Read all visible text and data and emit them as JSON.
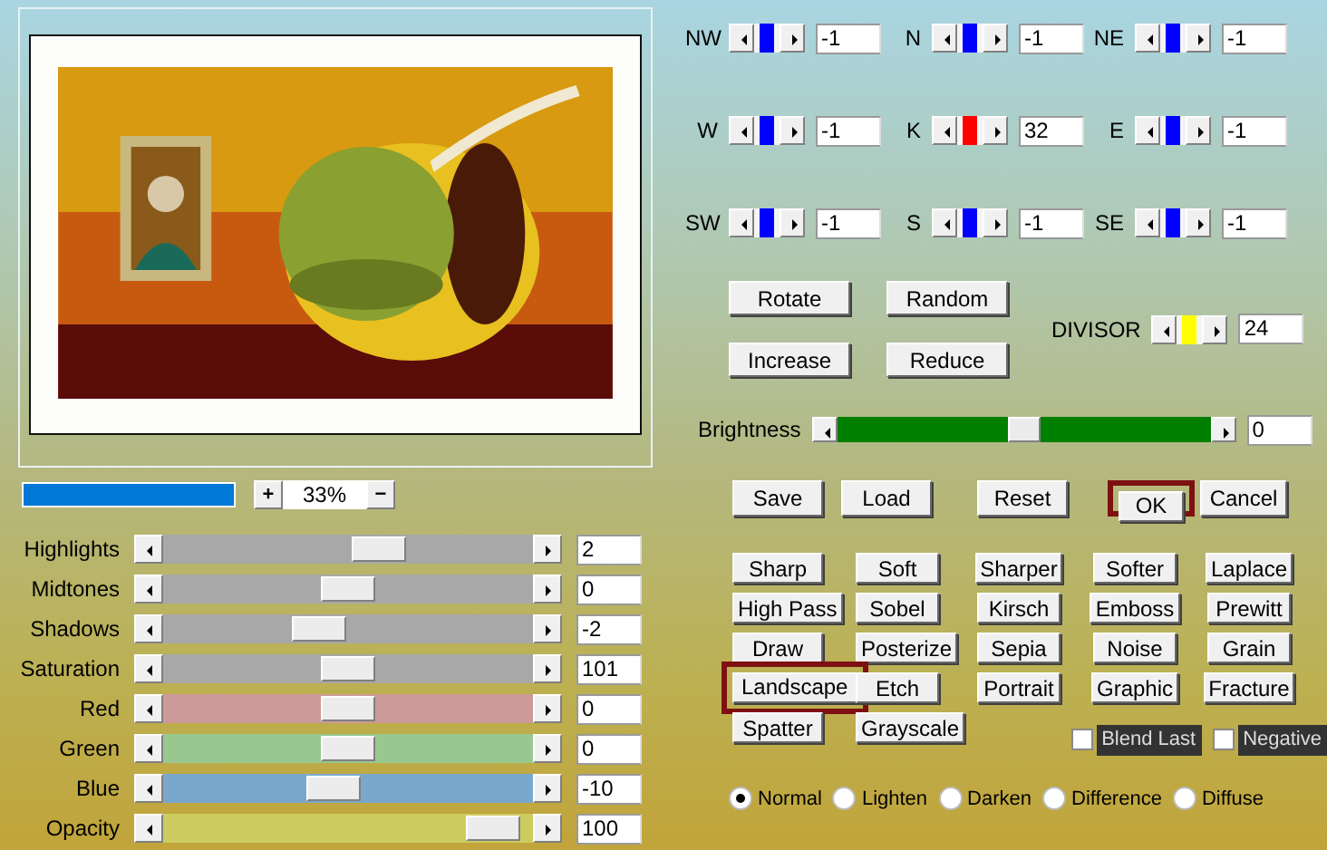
{
  "progress": {
    "level": 1
  },
  "zoom": {
    "plus": "+",
    "value": "33%",
    "minus": "−"
  },
  "adjustments": [
    {
      "label": "Highlights",
      "level": 0.6,
      "value": "2",
      "color": "#a8a8a8"
    },
    {
      "label": "Midtones",
      "level": 0.5,
      "value": "0",
      "color": "#a8a8a8"
    },
    {
      "label": "Shadows",
      "level": 0.41,
      "value": "-2",
      "color": "#a8a8a8"
    },
    {
      "label": "Saturation",
      "level": 0.5,
      "value": "101",
      "color": "#a8a8a8"
    },
    {
      "label": "Red",
      "level": 0.5,
      "value": "0",
      "color": "#cc9a98"
    },
    {
      "label": "Green",
      "level": 0.5,
      "value": "0",
      "color": "#98c890"
    },
    {
      "label": "Blue",
      "level": 0.455,
      "value": "-10",
      "color": "#7aa8cc"
    },
    {
      "label": "Opacity",
      "level": 0.96,
      "value": "100",
      "color": "#cccc60"
    }
  ],
  "matrix": [
    {
      "label": "NW",
      "level": 0.5,
      "value": "-1",
      "color": "#0000ff"
    },
    {
      "label": "N",
      "level": 0.5,
      "value": "-1",
      "color": "#0000ff"
    },
    {
      "label": "NE",
      "level": 0.5,
      "value": "-1",
      "color": "#0000ff"
    },
    {
      "label": "W",
      "level": 0.5,
      "value": "-1",
      "color": "#0000ff"
    },
    {
      "label": "K",
      "level": 0.5,
      "value": "32",
      "color": "#ff0000"
    },
    {
      "label": "E",
      "level": 0.5,
      "value": "-1",
      "color": "#0000ff"
    },
    {
      "label": "SW",
      "level": 0.5,
      "value": "-1",
      "color": "#0000ff"
    },
    {
      "label": "S",
      "level": 0.5,
      "value": "-1",
      "color": "#0000ff"
    },
    {
      "label": "SE",
      "level": 0.5,
      "value": "-1",
      "color": "#0000ff"
    }
  ],
  "matrix_buttons": [
    {
      "label": "Rotate",
      "marked": false
    },
    {
      "label": "Random",
      "marked": false
    },
    {
      "label": "Increase",
      "marked": false
    },
    {
      "label": "Reduce",
      "marked": false
    }
  ],
  "divisor": {
    "label": "DIVISOR",
    "level": 0.5,
    "value": "24",
    "color": "#ffff00"
  },
  "brightness": {
    "label": "Brightness",
    "level": 0.5,
    "value": "0",
    "color": "#008000"
  },
  "action_buttons": [
    {
      "label": "Save",
      "marked": false
    },
    {
      "label": "Load",
      "marked": false
    },
    {
      "label": "Reset",
      "marked": false
    },
    {
      "label": "OK",
      "marked": true
    },
    {
      "label": "Cancel",
      "marked": false
    }
  ],
  "preset_buttons": [
    [
      {
        "label": "Sharp",
        "marked": false
      },
      {
        "label": "Soft",
        "marked": false
      },
      {
        "label": "Sharper",
        "marked": false
      },
      {
        "label": "Softer",
        "marked": false
      },
      {
        "label": "Laplace",
        "marked": false
      }
    ],
    [
      {
        "label": "High Pass",
        "marked": false
      },
      {
        "label": "Sobel",
        "marked": false
      },
      {
        "label": "Kirsch",
        "marked": false
      },
      {
        "label": "Emboss",
        "marked": false
      },
      {
        "label": "Prewitt",
        "marked": false
      }
    ],
    [
      {
        "label": "Draw",
        "marked": false
      },
      {
        "label": "Posterize",
        "marked": false
      },
      {
        "label": "Sepia",
        "marked": false
      },
      {
        "label": "Noise",
        "marked": false
      },
      {
        "label": "Grain",
        "marked": false
      }
    ],
    [
      {
        "label": "Landscape",
        "marked": true
      },
      {
        "label": "Etch",
        "marked": false
      },
      {
        "label": "Portrait",
        "marked": false
      },
      {
        "label": "Graphic",
        "marked": false
      },
      {
        "label": "Fracture",
        "marked": false
      }
    ],
    [
      {
        "label": "Spatter",
        "marked": false
      },
      {
        "label": "Grayscale",
        "marked": false
      }
    ]
  ],
  "options": [
    {
      "label": "Blend Last",
      "checked": false
    },
    {
      "label": "Negative",
      "checked": false
    }
  ],
  "blend_modes": [
    {
      "label": "Normal",
      "selected": true
    },
    {
      "label": "Lighten",
      "selected": false
    },
    {
      "label": "Darken",
      "selected": false
    },
    {
      "label": "Difference",
      "selected": false
    },
    {
      "label": "Diffuse",
      "selected": false
    }
  ]
}
